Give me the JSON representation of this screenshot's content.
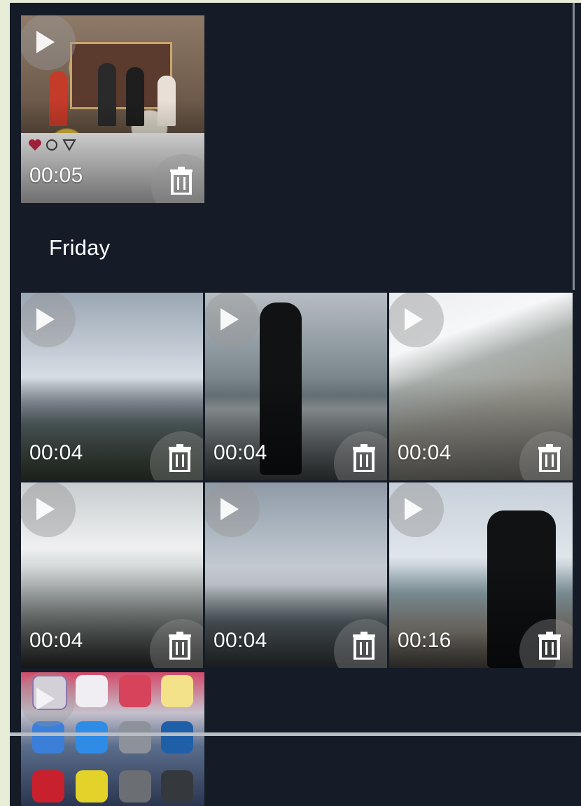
{
  "section": {
    "title": "Friday"
  },
  "top_item": {
    "duration": "00:05"
  },
  "grid": [
    {
      "duration": "00:04"
    },
    {
      "duration": "00:04"
    },
    {
      "duration": "00:04"
    },
    {
      "duration": "00:04"
    },
    {
      "duration": "00:04"
    },
    {
      "duration": "00:16"
    }
  ],
  "icons": {
    "play": "play-icon",
    "delete": "trash-icon"
  },
  "colors": {
    "background": "#151c28",
    "text": "#ffffff",
    "overlay": "#969696"
  }
}
